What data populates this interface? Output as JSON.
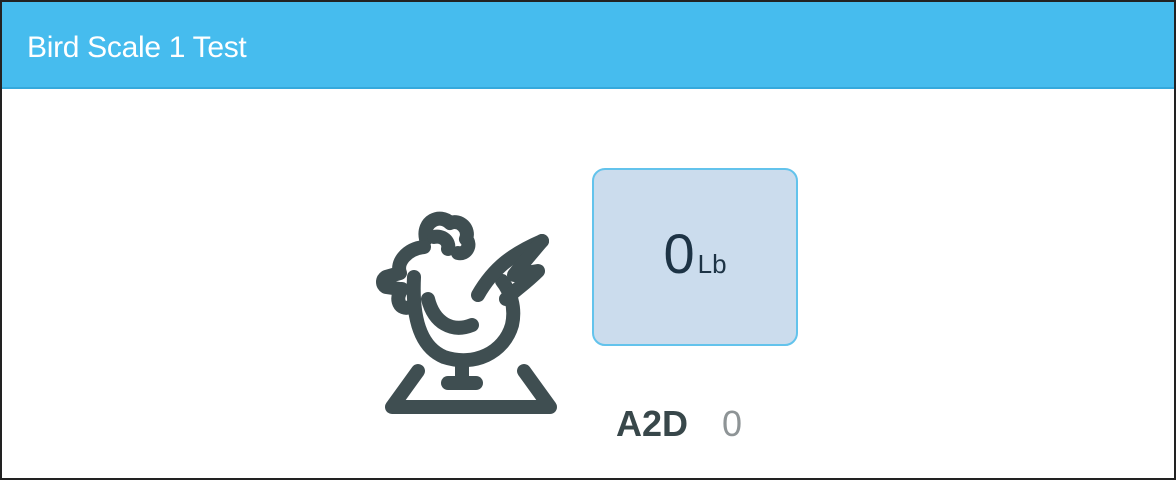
{
  "window": {
    "title": "Bird Scale 1 Test"
  },
  "scale": {
    "icon": "bird-on-scale-icon",
    "weight_value": "0",
    "weight_unit": "Lb",
    "a2d_label": "A2D",
    "a2d_value": "0"
  },
  "colors": {
    "header": "#46bcee",
    "weight_box_fill": "#cbdced",
    "weight_box_border": "#63c3ec",
    "icon": "#3f4e51"
  }
}
